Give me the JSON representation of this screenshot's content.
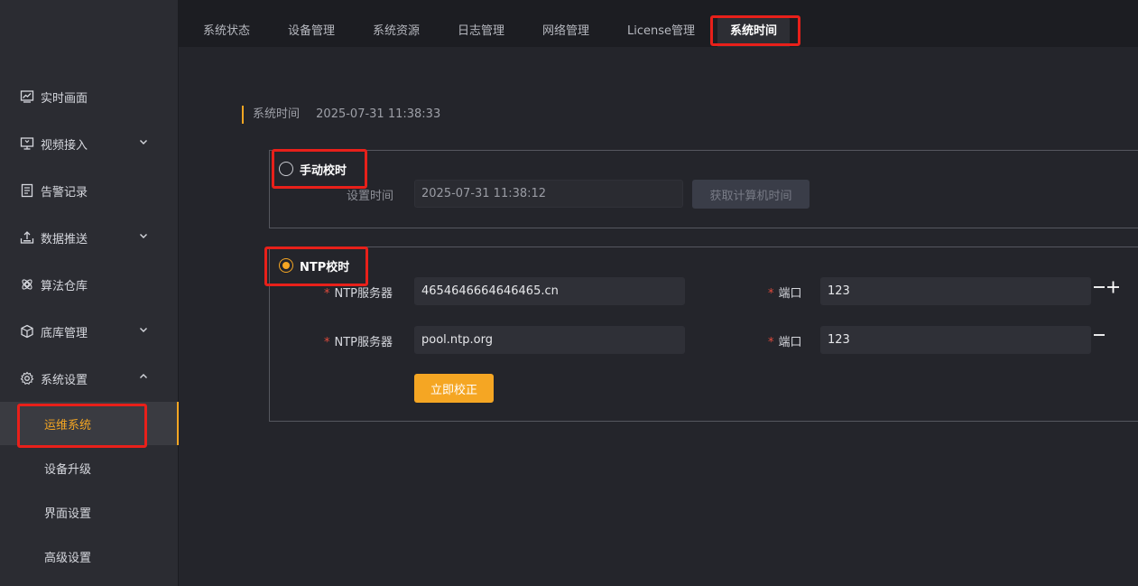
{
  "tabs": [
    {
      "label": "系统状态"
    },
    {
      "label": "设备管理"
    },
    {
      "label": "系统资源"
    },
    {
      "label": "日志管理"
    },
    {
      "label": "网络管理"
    },
    {
      "label": "License管理"
    },
    {
      "label": "系统时间",
      "active": true
    }
  ],
  "sidebar": {
    "items": [
      {
        "label": "实时画面",
        "icon": "monitor-chart-icon"
      },
      {
        "label": "视频接入",
        "icon": "video-input-icon",
        "expandable": true
      },
      {
        "label": "告警记录",
        "icon": "document-list-icon"
      },
      {
        "label": "数据推送",
        "icon": "upload-tray-icon",
        "expandable": true
      },
      {
        "label": "算法仓库",
        "icon": "molecule-icon"
      },
      {
        "label": "底库管理",
        "icon": "cube-icon",
        "expandable": true
      },
      {
        "label": "系统设置",
        "icon": "gear-icon",
        "expanded": true
      }
    ],
    "sub_items": [
      {
        "label": "运维系统",
        "active": true
      },
      {
        "label": "设备升级"
      },
      {
        "label": "界面设置"
      },
      {
        "label": "高级设置"
      }
    ]
  },
  "system_time": {
    "label": "系统时间",
    "value": "2025-07-31 11:38:33"
  },
  "manual": {
    "radio_label": "手动校时",
    "checked": false,
    "set_time_label": "设置时间",
    "set_time_value": "2025-07-31 11:38:12",
    "get_pc_time_button": "获取计算机时间"
  },
  "ntp": {
    "radio_label": "NTP校时",
    "checked": true,
    "required_mark": "*",
    "servers": [
      {
        "server_label": "NTP服务器",
        "server_value": "4654646664646465.cn",
        "port_label": "端口",
        "port_value": "123"
      },
      {
        "server_label": "NTP服务器",
        "server_value": "pool.ntp.org",
        "port_label": "端口",
        "port_value": "123"
      }
    ],
    "sync_now_button": "立即校正"
  },
  "colors": {
    "accent": "#f5a623",
    "highlight": "#e8201a",
    "required": "#e04b3c"
  }
}
